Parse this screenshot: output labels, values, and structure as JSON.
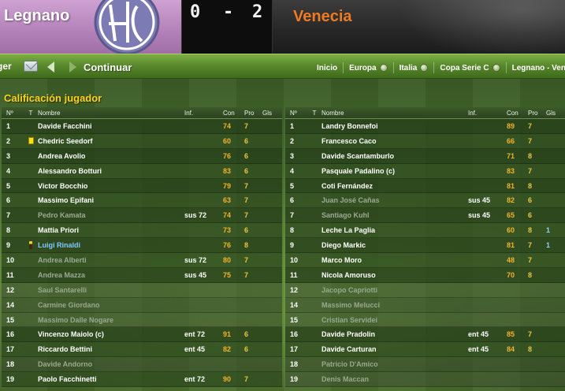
{
  "match": {
    "home": {
      "name": "Legnano",
      "score": "0"
    },
    "separator": "-",
    "away": {
      "name": "Venecia",
      "score": "2"
    }
  },
  "nav": {
    "clipped_text": "ger",
    "continue_label": "Continuar",
    "breadcrumbs": [
      "Inicio",
      "Europa",
      "Italia",
      "Copa Serie C",
      "Legnano - Venecia"
    ],
    "icons": [
      "mail-icon",
      "back-arrow-icon",
      "forward-arrow-icon"
    ]
  },
  "section_title": "Calificación jugador",
  "columns": {
    "num": "Nº",
    "t": "T",
    "name": "Nombre",
    "inf": "Inf.",
    "con": "Con",
    "pro": "Pro",
    "gls": "Gls"
  },
  "colors": {
    "rating": "#f2b32a",
    "accent_title": "#ffd21c",
    "away_name": "#f07a22",
    "home_band": "#b583bb"
  },
  "home_players": [
    {
      "num": "1",
      "name": "Davide Facchini",
      "inf": "",
      "con": "74",
      "pro": "7",
      "gls": "",
      "icon": "",
      "style": ""
    },
    {
      "num": "2",
      "name": "Chedric Seedorf",
      "inf": "",
      "con": "60",
      "pro": "6",
      "gls": "",
      "icon": "yellow-card-icon",
      "style": ""
    },
    {
      "num": "3",
      "name": "Andrea Avolio",
      "inf": "",
      "con": "76",
      "pro": "6",
      "gls": "",
      "icon": "",
      "style": ""
    },
    {
      "num": "4",
      "name": "Alessandro Botturi",
      "inf": "",
      "con": "83",
      "pro": "6",
      "gls": "",
      "icon": "",
      "style": ""
    },
    {
      "num": "5",
      "name": "Victor Bocchio",
      "inf": "",
      "con": "79",
      "pro": "7",
      "gls": "",
      "icon": "",
      "style": ""
    },
    {
      "num": "6",
      "name": "Massimo Epifani",
      "inf": "",
      "con": "63",
      "pro": "7",
      "gls": "",
      "icon": "",
      "style": ""
    },
    {
      "num": "7",
      "name": "Pedro Kamata",
      "inf": "sus 72",
      "con": "74",
      "pro": "7",
      "gls": "",
      "icon": "",
      "style": "subbed"
    },
    {
      "num": "8",
      "name": "Mattia Priori",
      "inf": "",
      "con": "73",
      "pro": "6",
      "gls": "",
      "icon": "",
      "style": ""
    },
    {
      "num": "9",
      "name": "Luigi Rinaldi",
      "inf": "",
      "con": "76",
      "pro": "8",
      "gls": "",
      "icon": "injury-icon",
      "style": "highlight"
    },
    {
      "num": "10",
      "name": "Andrea Alberti",
      "inf": "sus 72",
      "con": "80",
      "pro": "7",
      "gls": "",
      "icon": "",
      "style": "subbed"
    },
    {
      "num": "11",
      "name": "Andrea Mazza",
      "inf": "sus 45",
      "con": "75",
      "pro": "7",
      "gls": "",
      "icon": "",
      "style": "subbed"
    },
    {
      "num": "12",
      "name": "Saul Santarelli",
      "inf": "",
      "con": "",
      "pro": "",
      "gls": "",
      "icon": "",
      "style": "bench"
    },
    {
      "num": "14",
      "name": "Carmine Giordano",
      "inf": "",
      "con": "",
      "pro": "",
      "gls": "",
      "icon": "",
      "style": "bench"
    },
    {
      "num": "15",
      "name": "Massimo Dalle Nogare",
      "inf": "",
      "con": "",
      "pro": "",
      "gls": "",
      "icon": "",
      "style": "bench"
    },
    {
      "num": "16",
      "name": "Vincenzo Maiolo (c)",
      "inf": "ent 72",
      "con": "91",
      "pro": "6",
      "gls": "",
      "icon": "",
      "style": ""
    },
    {
      "num": "17",
      "name": "Riccardo Bettini",
      "inf": "ent 45",
      "con": "82",
      "pro": "6",
      "gls": "",
      "icon": "",
      "style": ""
    },
    {
      "num": "18",
      "name": "Davide Andorno",
      "inf": "",
      "con": "",
      "pro": "",
      "gls": "",
      "icon": "",
      "style": "bench"
    },
    {
      "num": "19",
      "name": "Paolo Facchinetti",
      "inf": "ent 72",
      "con": "90",
      "pro": "7",
      "gls": "",
      "icon": "",
      "style": ""
    }
  ],
  "away_players": [
    {
      "num": "1",
      "name": "Landry Bonnefoi",
      "inf": "",
      "con": "89",
      "pro": "7",
      "gls": "",
      "icon": "",
      "style": ""
    },
    {
      "num": "2",
      "name": "Francesco Caco",
      "inf": "",
      "con": "66",
      "pro": "7",
      "gls": "",
      "icon": "",
      "style": ""
    },
    {
      "num": "3",
      "name": "Davide Scantamburlo",
      "inf": "",
      "con": "71",
      "pro": "8",
      "gls": "",
      "icon": "",
      "style": ""
    },
    {
      "num": "4",
      "name": "Pasquale Padalino (c)",
      "inf": "",
      "con": "83",
      "pro": "7",
      "gls": "",
      "icon": "",
      "style": ""
    },
    {
      "num": "5",
      "name": "Coti Fernández",
      "inf": "",
      "con": "81",
      "pro": "8",
      "gls": "",
      "icon": "",
      "style": ""
    },
    {
      "num": "6",
      "name": "Juan José Cañas",
      "inf": "sus 45",
      "con": "82",
      "pro": "6",
      "gls": "",
      "icon": "",
      "style": "subbed"
    },
    {
      "num": "7",
      "name": "Santiago Kuhl",
      "inf": "sus 45",
      "con": "65",
      "pro": "6",
      "gls": "",
      "icon": "",
      "style": "subbed"
    },
    {
      "num": "8",
      "name": "Leche La Paglia",
      "inf": "",
      "con": "60",
      "pro": "8",
      "gls": "1",
      "icon": "",
      "style": ""
    },
    {
      "num": "9",
      "name": "Diego Markic",
      "inf": "",
      "con": "81",
      "pro": "7",
      "gls": "1",
      "icon": "",
      "style": ""
    },
    {
      "num": "10",
      "name": "Marco Moro",
      "inf": "",
      "con": "48",
      "pro": "7",
      "gls": "",
      "icon": "",
      "style": ""
    },
    {
      "num": "11",
      "name": "Nicola Amoruso",
      "inf": "",
      "con": "70",
      "pro": "8",
      "gls": "",
      "icon": "",
      "style": ""
    },
    {
      "num": "12",
      "name": "Jacopo Capriotti",
      "inf": "",
      "con": "",
      "pro": "",
      "gls": "",
      "icon": "",
      "style": "bench"
    },
    {
      "num": "14",
      "name": "Massimo Melucci",
      "inf": "",
      "con": "",
      "pro": "",
      "gls": "",
      "icon": "",
      "style": "bench"
    },
    {
      "num": "15",
      "name": "Cristian Servidei",
      "inf": "",
      "con": "",
      "pro": "",
      "gls": "",
      "icon": "",
      "style": "bench"
    },
    {
      "num": "16",
      "name": "Davide Pradolin",
      "inf": "ent 45",
      "con": "85",
      "pro": "7",
      "gls": "",
      "icon": "",
      "style": ""
    },
    {
      "num": "17",
      "name": "Davide Carturan",
      "inf": "ent 45",
      "con": "84",
      "pro": "8",
      "gls": "",
      "icon": "",
      "style": ""
    },
    {
      "num": "18",
      "name": "Patricio D'Amico",
      "inf": "",
      "con": "",
      "pro": "",
      "gls": "",
      "icon": "",
      "style": "bench"
    },
    {
      "num": "19",
      "name": "Denis Maccan",
      "inf": "",
      "con": "",
      "pro": "",
      "gls": "",
      "icon": "",
      "style": "bench"
    }
  ]
}
